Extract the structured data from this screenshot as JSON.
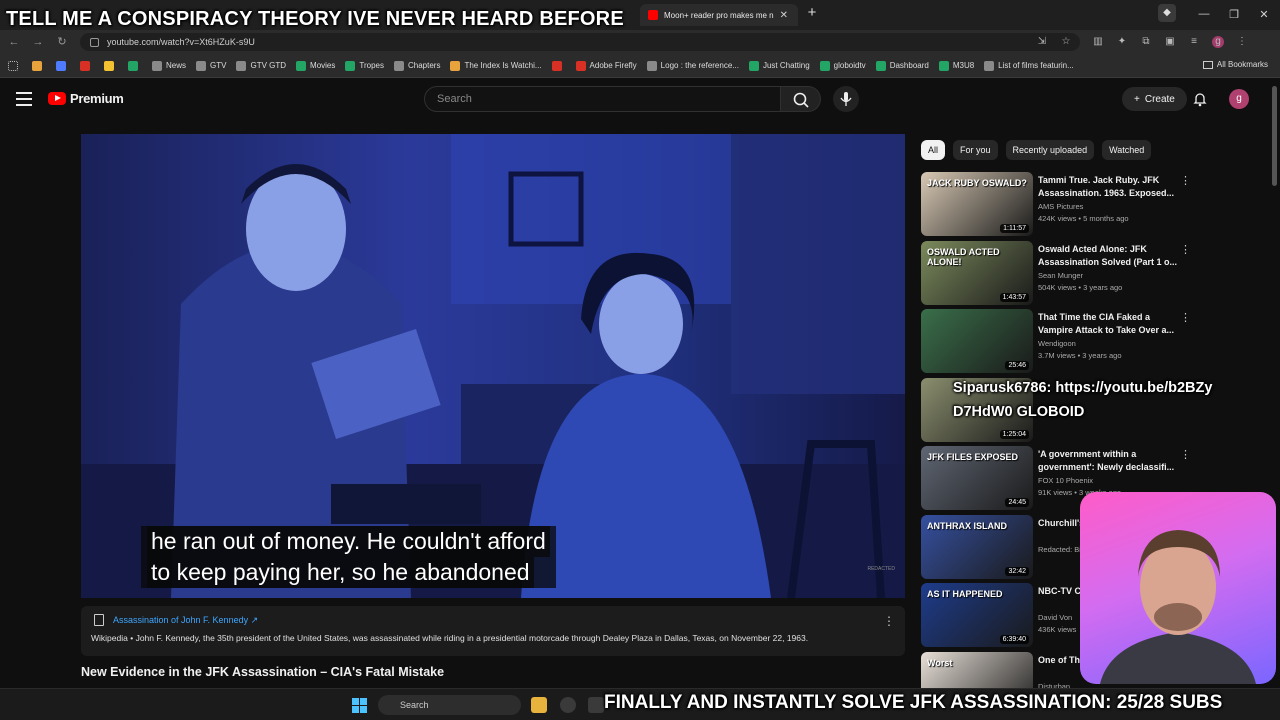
{
  "overlay": {
    "top_caption": "TELL ME A CONSPIRACY THEORY IVE NEVER HEARD BEFORE",
    "link_text_line1": "Siparusk6786: https://youtu.be/b2BZy",
    "link_text_line2": "D7HdW0 GLOBOID",
    "bottom_caption": "FINALLY AND INSTANTLY SOLVE JFK ASSASSINATION: 25/28 SUBS"
  },
  "browser": {
    "tabs": [
      {
        "label": "Moon+ reader pro makes me n",
        "active": true
      }
    ],
    "url": "youtube.com/watch?v=Xt6HZuK-s9U",
    "new_tab": "+",
    "bookmarks": [
      {
        "label": "",
        "color": "#e8a33d"
      },
      {
        "label": "",
        "color": "#4f7cff"
      },
      {
        "label": "",
        "color": "#d93025"
      },
      {
        "label": "",
        "color": "#f2c230"
      },
      {
        "label": "",
        "color": "#22a565"
      },
      {
        "label": "News",
        "color": "#8a8a8a"
      },
      {
        "label": "GTV",
        "color": "#8a8a8a"
      },
      {
        "label": "GTV GTD",
        "color": "#8a8a8a"
      },
      {
        "label": "Movies",
        "color": "#22a565"
      },
      {
        "label": "Tropes",
        "color": "#22a565"
      },
      {
        "label": "Chapters",
        "color": "#8a8a8a"
      },
      {
        "label": "The Index Is Watchi...",
        "color": "#e8a33d"
      },
      {
        "label": "",
        "color": "#d93025"
      },
      {
        "label": "Adobe Firefly",
        "color": "#d93025"
      },
      {
        "label": "Logo : the reference...",
        "color": "#8a8a8a"
      },
      {
        "label": "Just Chatting",
        "color": "#22a565"
      },
      {
        "label": "globoidtv",
        "color": "#22a565"
      },
      {
        "label": "Dashboard",
        "color": "#22a565"
      },
      {
        "label": "M3U8",
        "color": "#22a565"
      },
      {
        "label": "List of films featurin...",
        "color": "#8a8a8a"
      }
    ],
    "all_bookmarks": "All Bookmarks"
  },
  "youtube": {
    "brand": "Premium",
    "search_placeholder": "Search",
    "create_label": "Create",
    "avatar_letter": "g",
    "subtitle_line1": "he ran out of money. He couldn't afford",
    "subtitle_line2": "to keep paying her, so he abandoned",
    "player_watermark": "REDACTED",
    "info_card": {
      "title": "Assassination of John F. Kennedy",
      "source": "Wikipedia",
      "text": "John F. Kennedy, the 35th president of the United States, was assassinated while riding in a presidential motorcade through Dealey Plaza in Dallas, Texas, on November 22, 1963."
    },
    "video_title": "New Evidence in the JFK Assassination – CIA's Fatal Mistake",
    "chips": [
      {
        "label": "All",
        "active": true
      },
      {
        "label": "For you",
        "active": false
      },
      {
        "label": "Recently uploaded",
        "active": false
      },
      {
        "label": "Watched",
        "active": false
      }
    ],
    "recommendations": [
      {
        "title": "Tammi True. Jack Ruby. JFK Assassination. 1963. Exposed...",
        "channel": "AMS Pictures",
        "meta": "424K views • 5 months ago",
        "duration": "1:11:57",
        "thumb_text": "JACK RUBY OSWALD?",
        "thumb_color": "#d8c9b4"
      },
      {
        "title": "Oswald Acted Alone: JFK Assassination Solved (Part 1 o...",
        "channel": "Sean Munger",
        "meta": "504K views • 3 years ago",
        "duration": "1:43:57",
        "thumb_text": "OSWALD ACTED ALONE!",
        "thumb_color": "#7b8a5c"
      },
      {
        "title": "That Time the CIA Faked a Vampire Attack to Take Over a...",
        "channel": "Wendigoon",
        "meta": "3.7M views • 3 years ago",
        "duration": "25:46",
        "thumb_text": "",
        "thumb_color": "#3a6f4a"
      },
      {
        "title": "",
        "channel": "",
        "meta": "",
        "duration": "1:25:04",
        "thumb_text": "",
        "thumb_color": "#8b8f6e"
      },
      {
        "title": "'A government within a government': Newly declassifi...",
        "channel": "FOX 10 Phoenix",
        "meta": "91K views • 3 weeks ago",
        "duration": "24:45",
        "thumb_text": "JFK FILES EXPOSED",
        "thumb_color": "#5f6673"
      },
      {
        "title": "Churchill's S",
        "channel": "Redacted: Bio",
        "meta": "",
        "duration": "32:42",
        "thumb_text": "ANTHRAX ISLAND",
        "thumb_color": "#3550a0"
      },
      {
        "title": "NBC-TV C ASSASSI",
        "channel": "David Von",
        "meta": "436K views",
        "duration": "6:39:40",
        "thumb_text": "AS IT HAPPENED",
        "thumb_color": "#1e3c8c"
      },
      {
        "title": "One of The Exist - Ja",
        "channel": "Disturban",
        "meta": "",
        "duration": "",
        "thumb_text": "Worst",
        "thumb_color": "#e8e0d8"
      }
    ]
  },
  "taskbar": {
    "search_label": "Search"
  },
  "colors": {
    "accent_red": "#ff0000",
    "link_blue": "#3ea6ff",
    "background": "#0f0f0f"
  }
}
